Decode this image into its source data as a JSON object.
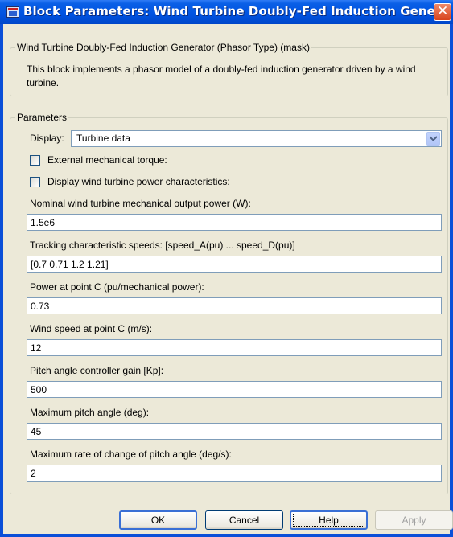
{
  "window": {
    "title": "Block Parameters: Wind Turbine Doubly-Fed Induction Gene...",
    "icon": "simulink-block-icon",
    "close_icon": "close-icon"
  },
  "mask": {
    "group_title": "Wind Turbine Doubly-Fed Induction Generator (Phasor Type) (mask)",
    "description": "This block implements a phasor model of a doubly-fed induction generator driven by a wind turbine."
  },
  "parameters": {
    "group_title": "Parameters",
    "display_label": "Display:",
    "display_value": "Turbine data",
    "ext_torque_label": "External mechanical torque:",
    "ext_torque_checked": false,
    "display_power_label": "Display wind turbine power characteristics:",
    "display_power_checked": false,
    "fields": [
      {
        "label": "Nominal wind turbine mechanical output power (W):",
        "value": "1.5e6"
      },
      {
        "label": "Tracking characteristic speeds: [speed_A(pu) ... speed_D(pu)]",
        "value": "[0.7 0.71 1.2 1.21]"
      },
      {
        "label": "Power at point C (pu/mechanical power):",
        "value": "0.73"
      },
      {
        "label": "Wind speed at point C (m/s):",
        "value": "12"
      },
      {
        "label": "Pitch angle controller gain [Kp]:",
        "value": "500"
      },
      {
        "label": "Maximum pitch angle (deg):",
        "value": "45"
      },
      {
        "label": "Maximum rate of change of pitch angle (deg/s):",
        "value": "2"
      }
    ]
  },
  "buttons": {
    "ok": "OK",
    "cancel": "Cancel",
    "help": "Help",
    "apply": "Apply"
  }
}
